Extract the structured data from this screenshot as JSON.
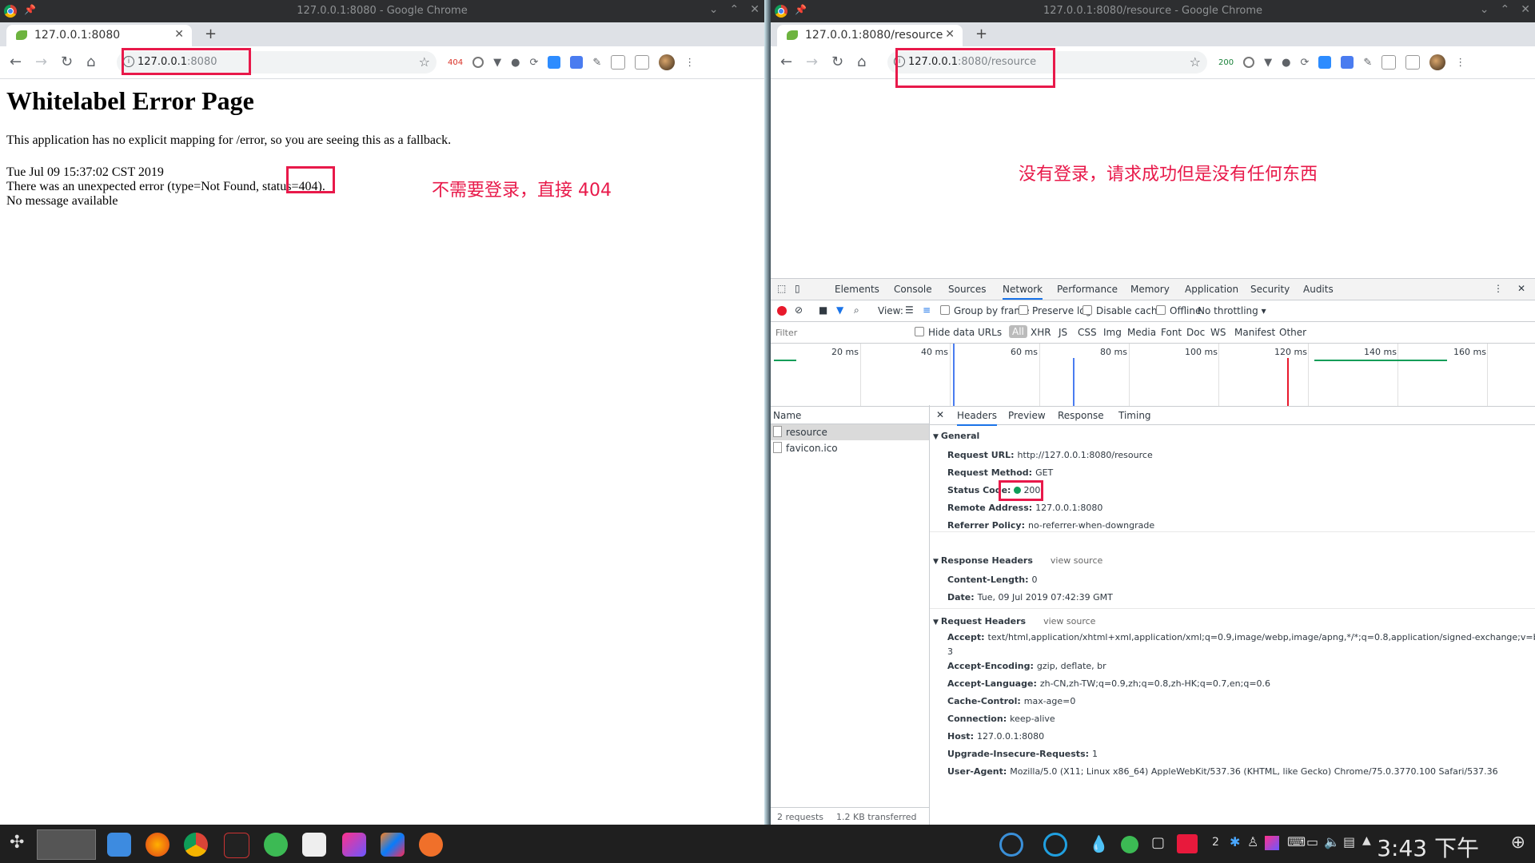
{
  "left_window": {
    "title": "127.0.0.1:8080 - Google Chrome",
    "tab_title": "127.0.0.1:8080",
    "url_host": "127.0.0.1",
    "url_rest": ":8080",
    "ext_badge": "404",
    "page": {
      "heading": "Whitelabel Error Page",
      "intro": "This application has no explicit mapping for /error, so you are seeing this as a fallback.",
      "timestamp": "Tue Jul 09 15:37:02 CST 2019",
      "error_line": "There was an unexpected error (type=Not Found, status=404).",
      "message": "No message available"
    },
    "annotation": "不需要登录，直接 404"
  },
  "right_window": {
    "title": "127.0.0.1:8080/resource - Google Chrome",
    "tab_title": "127.0.0.1:8080/resource",
    "url_host": "127.0.0.1",
    "url_rest": ":8080/resource",
    "ext_badge": "200",
    "annotation": "没有登录，请求成功但是没有任何东西",
    "devtools": {
      "tabs": [
        "Elements",
        "Console",
        "Sources",
        "Network",
        "Performance",
        "Memory",
        "Application",
        "Security",
        "Audits"
      ],
      "view_label": "View:",
      "group_by_frame": "Group by frame",
      "preserve_log": "Preserve log",
      "disable_cache": "Disable cache",
      "offline": "Offline",
      "throttling": "No throttling",
      "filter_placeholder": "Filter",
      "hide_data_urls": "Hide data URLs",
      "type_filters": [
        "All",
        "XHR",
        "JS",
        "CSS",
        "Img",
        "Media",
        "Font",
        "Doc",
        "WS",
        "Manifest",
        "Other"
      ],
      "timeline_ticks": [
        "20 ms",
        "40 ms",
        "60 ms",
        "80 ms",
        "100 ms",
        "120 ms",
        "140 ms",
        "160 ms"
      ],
      "name_header": "Name",
      "requests": [
        "resource",
        "favicon.ico"
      ],
      "summary_requests": "2 requests",
      "summary_transferred": "1.2 KB transferred",
      "detail_tabs": [
        "Headers",
        "Preview",
        "Response",
        "Timing"
      ],
      "general_title": "General",
      "general": [
        {
          "k": "Request URL:",
          "v": "http://127.0.0.1:8080/resource"
        },
        {
          "k": "Request Method:",
          "v": "GET"
        },
        {
          "k": "Status Code:",
          "v": "200"
        },
        {
          "k": "Remote Address:",
          "v": "127.0.0.1:8080"
        },
        {
          "k": "Referrer Policy:",
          "v": "no-referrer-when-downgrade"
        }
      ],
      "response_title": "Response Headers",
      "view_source": "view source",
      "response_headers": [
        {
          "k": "Content-Length:",
          "v": "0"
        },
        {
          "k": "Date:",
          "v": "Tue, 09 Jul 2019 07:42:39 GMT"
        }
      ],
      "request_title": "Request Headers",
      "accept_k": "Accept:",
      "accept_v1": "text/html,application/xhtml+xml,application/xml;q=0.9,image/webp,image/apng,*/*;q=0.8,application/signed-exchange;v=b",
      "accept_v2": "3",
      "request_headers": [
        {
          "k": "Accept-Encoding:",
          "v": "gzip, deflate, br"
        },
        {
          "k": "Accept-Language:",
          "v": "zh-CN,zh-TW;q=0.9,zh;q=0.8,zh-HK;q=0.7,en;q=0.6"
        },
        {
          "k": "Cache-Control:",
          "v": "max-age=0"
        },
        {
          "k": "Connection:",
          "v": "keep-alive"
        },
        {
          "k": "Host:",
          "v": "127.0.0.1:8080"
        },
        {
          "k": "Upgrade-Insecure-Requests:",
          "v": "1"
        },
        {
          "k": "User-Agent:",
          "v": "Mozilla/5.0 (X11; Linux x86_64) AppleWebKit/537.36 (KHTML, like Gecko) Chrome/75.0.3770.100 Safari/537.36"
        }
      ]
    }
  },
  "taskbar": {
    "clock": "3:43 下午",
    "notification_count": "2"
  },
  "colors": {
    "annotation": "#e8194a",
    "accent": "#1a73e8"
  }
}
